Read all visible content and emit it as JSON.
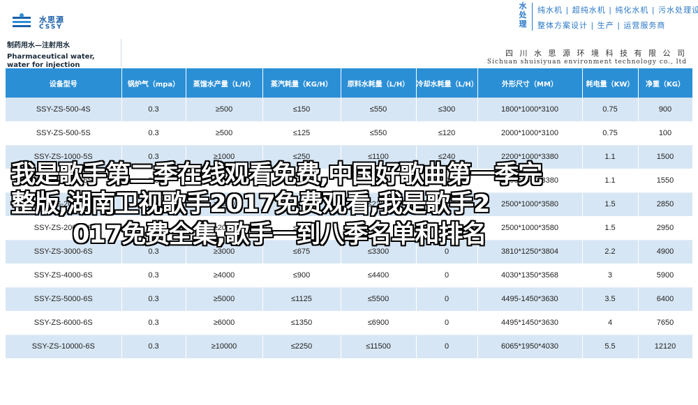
{
  "header": {
    "logo_cn": "水思源",
    "logo_en": "CSSY",
    "slogan_vertical": [
      "水",
      "处",
      "理"
    ],
    "slogan_line1": "纯水机 | 超纯水机 | 纯化水机 | 污水处理设备",
    "slogan_line2": "整体方案设计 | 生产 | 运营服务商"
  },
  "band": {
    "title_line1": "制药用水—注射用水",
    "title_line2": "Pharmaceutical water, water for injection",
    "company_cn": "四 川 水 思 源 环 境 科 技 有 限 公 司",
    "company_en": "Sichuan shuisiyuan environment technology co., ltd"
  },
  "table": {
    "headers": [
      "设备型号",
      "锅炉气（mpa）",
      "蒸馏水产量（L/H）",
      "蒸汽耗量（KG/H）",
      "原料水耗量（L/H）",
      "冷却水耗量（L/H）",
      "外形尺寸（MM）",
      "耗电量（KW）",
      "净重（KG）"
    ],
    "rows": [
      [
        "SSY-ZS-500-4S",
        "0.3",
        "≥500",
        "≤150",
        "≤550",
        "≤300",
        "1800*1000*3100",
        "0.75",
        "900"
      ],
      [
        "SSY-ZS-500-5S",
        "0.3",
        "≥500",
        "≤125",
        "≤550",
        "≤120",
        "2000*1000*3100",
        "0.75",
        "100"
      ],
      [
        "SSY-ZS-1000-5S",
        "0.3",
        "≥1000",
        "≤250",
        "≤1100",
        "≤240",
        "2200*1000*3380",
        "1.1",
        "1500"
      ],
      [
        "SSY-ZS-1000-6S",
        "0.3",
        "≥1000",
        "≤225",
        "≤1100",
        "0",
        "2200*1000*3380",
        "1.1",
        "1550"
      ],
      [
        "SSY-ZS-2000-5S",
        "0.3",
        "≥2000",
        "≤500",
        "≤2200",
        "≤480",
        "2500*1000*3580",
        "1.5",
        "2850"
      ],
      [
        "SSY-ZS-2000-6S",
        "0.3",
        "≥2000",
        "≤450",
        "≤2200",
        "0",
        "2500*1000*3580",
        "1.5",
        "2950"
      ],
      [
        "SSY-ZS-3000-6S",
        "0.3",
        "≥3000",
        "≤675",
        "≤3300",
        "0",
        "3810*1250*3804",
        "2.2",
        "4900"
      ],
      [
        "SSY-ZS-4000-6S",
        "0.3",
        "≥4000",
        "≤900",
        "≤4400",
        "0",
        "4030*1350*3568",
        "3",
        "5900"
      ],
      [
        "SSY-ZS-5000-6S",
        "0.3",
        "≥5000",
        "≤1125",
        "≤5500",
        "0",
        "4495-1450*3630",
        "3.5",
        "6400"
      ],
      [
        "SSY-ZS-6000-6S",
        "0.3",
        "≥6000",
        "≤1350",
        "≤6900",
        "0",
        "4495*1450*3630",
        "4",
        "7650"
      ],
      [
        "SSY-ZS-10000-6S",
        "0.3",
        "≥10000",
        "≤2250",
        "≤11500",
        "0",
        "6065*1950*4030",
        "5.5",
        "12120"
      ]
    ]
  },
  "overlay": {
    "line1": "我是歌手第二季在线观看免费,中国好歌曲第一季完",
    "line2": "整版,湖南卫视歌手2017免费观看,我是歌手2",
    "line3": "017免费全集,歌手一到八季名单和排名"
  },
  "colors": {
    "header_blue": "#2b8fd6",
    "row_tint": "#d7e6f4",
    "brand_blue": "#1a5fa8"
  }
}
